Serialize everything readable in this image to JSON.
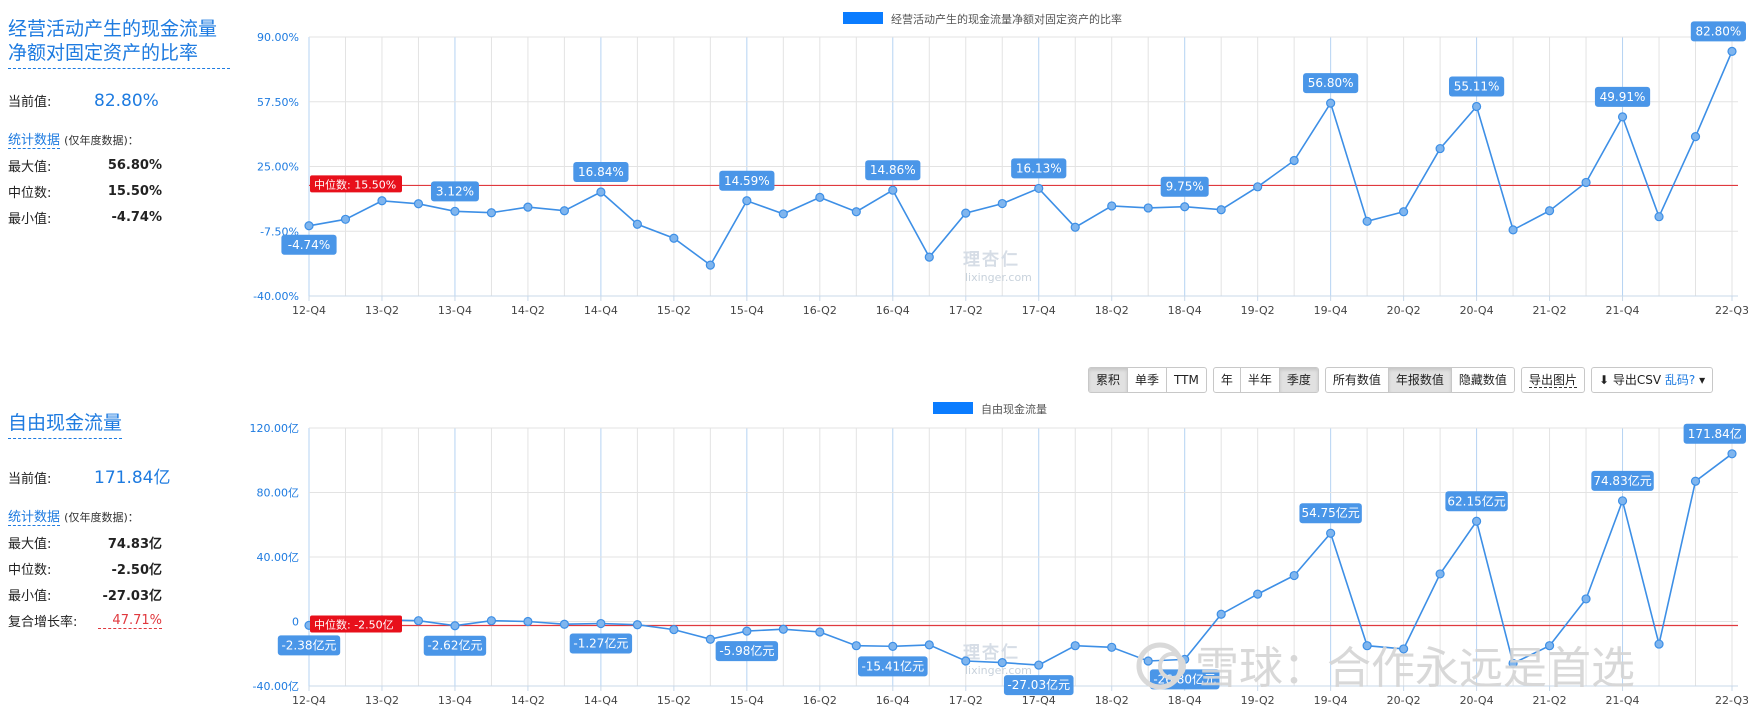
{
  "panel1": {
    "title": "经营活动产生的现金流量净额对固定资产的比率",
    "current_label": "当前值:",
    "current_value": "82.80%",
    "stats_link": "统计数据",
    "stats_note": "(仅年度数据)：",
    "stats": [
      {
        "label": "最大值:",
        "value": "56.80%"
      },
      {
        "label": "中位数:",
        "value": "15.50%"
      },
      {
        "label": "最小值:",
        "value": "-4.74%"
      }
    ]
  },
  "panel2": {
    "title": "自由现金流量",
    "current_label": "当前值:",
    "current_value": "171.84亿",
    "stats_link": "统计数据",
    "stats_note": "(仅年度数据)：",
    "stats": [
      {
        "label": "最大值:",
        "value": "74.83亿"
      },
      {
        "label": "中位数:",
        "value": "-2.50亿"
      },
      {
        "label": "最小值:",
        "value": "-27.03亿"
      },
      {
        "label": "复合增长率:",
        "value": "47.71%"
      }
    ]
  },
  "toolbar": {
    "calc_group": [
      "累积",
      "单季",
      "TTM"
    ],
    "calc_active": "单季",
    "period_group": [
      "年",
      "半年",
      "季度"
    ],
    "period_active": "季度",
    "label_group": [
      "所有数值",
      "年报数值",
      "隐藏数值"
    ],
    "label_active": "年报数值",
    "export_image": "导出图片",
    "export_csv": "导出CSV",
    "garbled": "乱码?"
  },
  "watermark": {
    "logo_text": "理杏仁",
    "logo_sub": "lixinger.com",
    "xueqiu": "雪球：合作永远是首选"
  },
  "colors": {
    "accent": "#1e7be0",
    "series": "#3d8fe6",
    "point_fill": "#7fb5ee",
    "median_line": "#e0393e",
    "median_label_bg": "#e8101b",
    "label_bg": "#4a96e8",
    "grid": "#e3e3e3",
    "grid_major": "#b5d3f3"
  },
  "chart_data": [
    {
      "type": "line",
      "legend": "经营活动产生的现金流量净额对固定资产的比率",
      "unit": "%",
      "x_tick_labels": [
        "12-Q4",
        "13-Q2",
        "13-Q4",
        "14-Q2",
        "14-Q4",
        "15-Q2",
        "15-Q4",
        "16-Q2",
        "16-Q4",
        "17-Q2",
        "17-Q4",
        "18-Q2",
        "18-Q4",
        "19-Q2",
        "19-Q4",
        "20-Q2",
        "20-Q4",
        "21-Q2",
        "21-Q4",
        "22-Q3"
      ],
      "y_ticks": [
        "90.00%",
        "57.50%",
        "25.00%",
        "-7.50%",
        "-40.00%"
      ],
      "y_tick_values": [
        90,
        57.5,
        25,
        -7.5,
        -40
      ],
      "ylim": [
        -40,
        90
      ],
      "x": [
        "12-Q4",
        "13-Q1",
        "13-Q2",
        "13-Q3",
        "13-Q4",
        "14-Q1",
        "14-Q2",
        "14-Q3",
        "14-Q4",
        "15-Q1",
        "15-Q2",
        "15-Q3",
        "15-Q4",
        "16-Q1",
        "16-Q2",
        "16-Q3",
        "16-Q4",
        "17-Q1",
        "17-Q2",
        "17-Q3",
        "17-Q4",
        "18-Q1",
        "18-Q2",
        "18-Q3",
        "18-Q4",
        "19-Q1",
        "19-Q2",
        "19-Q3",
        "19-Q4",
        "20-Q1",
        "20-Q2",
        "20-Q3",
        "20-Q4",
        "21-Q1",
        "21-Q2",
        "21-Q3",
        "21-Q4",
        "22-Q1",
        "22-Q2",
        "22-Q3"
      ],
      "values": [
        -4.74,
        -1.5,
        7.8,
        6.3,
        2.5,
        1.8,
        4.6,
        2.8,
        12.2,
        -4.0,
        -11.0,
        -24.5,
        7.8,
        1.2,
        9.5,
        2.3,
        13.1,
        -20.5,
        1.6,
        6.4,
        14.0,
        -5.5,
        5.2,
        4.2,
        4.8,
        3.3,
        14.8,
        28.0,
        56.8,
        -2.5,
        2.3,
        34.0,
        55.11,
        -6.8,
        2.8,
        17.0,
        49.91,
        -0.2,
        40.0,
        82.8
      ],
      "data_labels": [
        {
          "x": "12-Q4",
          "text": "-4.74%"
        },
        {
          "x": "13-Q4",
          "text": "3.12%"
        },
        {
          "x": "14-Q4",
          "text": "16.84%"
        },
        {
          "x": "15-Q4",
          "text": "14.59%"
        },
        {
          "x": "16-Q4",
          "text": "14.86%"
        },
        {
          "x": "17-Q4",
          "text": "16.13%"
        },
        {
          "x": "18-Q4",
          "text": "9.75%"
        },
        {
          "x": "19-Q4",
          "text": "56.80%"
        },
        {
          "x": "20-Q4",
          "text": "55.11%"
        },
        {
          "x": "21-Q4",
          "text": "49.91%"
        },
        {
          "x": "22-Q3",
          "text": "82.80%"
        }
      ],
      "median": {
        "value": 15.5,
        "label": "中位数: 15.50%"
      }
    },
    {
      "type": "line",
      "legend": "自由现金流量",
      "unit": "亿",
      "x_tick_labels": [
        "12-Q4",
        "13-Q2",
        "13-Q4",
        "14-Q2",
        "14-Q4",
        "15-Q2",
        "15-Q4",
        "16-Q2",
        "16-Q4",
        "17-Q2",
        "17-Q4",
        "18-Q2",
        "18-Q4",
        "19-Q2",
        "19-Q4",
        "20-Q2",
        "20-Q4",
        "21-Q2",
        "21-Q4",
        "22-Q3"
      ],
      "y_ticks": [
        "120.00亿",
        "80.00亿",
        "40.00亿",
        "0",
        "-40.00亿"
      ],
      "y_tick_values": [
        120,
        80,
        40,
        0,
        -40
      ],
      "ylim": [
        -40,
        120
      ],
      "x": [
        "12-Q4",
        "13-Q1",
        "13-Q2",
        "13-Q3",
        "13-Q4",
        "14-Q1",
        "14-Q2",
        "14-Q3",
        "14-Q4",
        "15-Q1",
        "15-Q2",
        "15-Q3",
        "15-Q4",
        "16-Q1",
        "16-Q2",
        "16-Q3",
        "16-Q4",
        "17-Q1",
        "17-Q2",
        "17-Q3",
        "17-Q4",
        "18-Q1",
        "18-Q2",
        "18-Q3",
        "18-Q4",
        "19-Q1",
        "19-Q2",
        "19-Q3",
        "19-Q4",
        "20-Q1",
        "20-Q2",
        "20-Q3",
        "20-Q4",
        "21-Q1",
        "21-Q2",
        "21-Q3",
        "21-Q4",
        "22-Q1",
        "22-Q2",
        "22-Q3"
      ],
      "values": [
        -2.38,
        0.5,
        1.0,
        0.5,
        -2.62,
        0.5,
        0,
        -1.7,
        -1.27,
        -2.0,
        -5.0,
        -11.0,
        -5.98,
        -4.8,
        -6.5,
        -15.0,
        -15.41,
        -14.5,
        -24.5,
        -25.5,
        -27.03,
        -15.0,
        -16.0,
        -24.5,
        -23.5,
        4.5,
        17.0,
        28.5,
        54.75,
        -15.0,
        -17.0,
        29.5,
        62.15,
        -26.0,
        -15.0,
        14.0,
        74.83,
        -14.0,
        87.0,
        104.0
      ],
      "data_labels": [
        {
          "x": "12-Q4",
          "text": "-2.38亿元"
        },
        {
          "x": "13-Q4",
          "text": "-2.62亿元"
        },
        {
          "x": "14-Q4",
          "text": "-1.27亿元"
        },
        {
          "x": "15-Q4",
          "text": "-5.98亿元"
        },
        {
          "x": "16-Q4",
          "text": "-15.41亿元"
        },
        {
          "x": "17-Q4",
          "text": "-27.03亿元"
        },
        {
          "x": "18-Q4",
          "text": "-26.80亿元"
        },
        {
          "x": "19-Q4",
          "text": "54.75亿元"
        },
        {
          "x": "20-Q4",
          "text": "62.15亿元"
        },
        {
          "x": "21-Q4",
          "text": "74.83亿元"
        },
        {
          "x": "22-Q3",
          "text": "171.84亿"
        }
      ],
      "median": {
        "value": -2.5,
        "label": "中位数: -2.50亿"
      }
    }
  ]
}
